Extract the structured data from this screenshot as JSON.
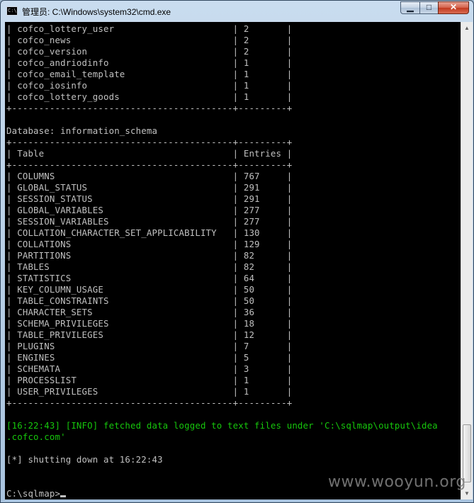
{
  "window": {
    "title": "管理员: C:\\Windows\\system32\\cmd.exe",
    "icon_text": "C:\\",
    "controls": {
      "minimize": "▁",
      "maximize": "□",
      "close": "✕"
    }
  },
  "scrollbar": {
    "up_arrow": "▲",
    "down_arrow": "▼"
  },
  "console": {
    "lines": [
      "| cofco_lottery_user                      | 2       |",
      "| cofco_news                              | 2       |",
      "| cofco_version                           | 2       |",
      "| cofco_andriodinfo                       | 1       |",
      "| cofco_email_template                    | 1       |",
      "| cofco_iosinfo                           | 1       |",
      "| cofco_lottery_goods                     | 1       |",
      "+-----------------------------------------+---------+",
      "",
      "Database: information_schema",
      "+-----------------------------------------+---------+",
      "| Table                                   | Entries |",
      "+-----------------------------------------+---------+",
      "| COLUMNS                                 | 767     |",
      "| GLOBAL_STATUS                           | 291     |",
      "| SESSION_STATUS                          | 291     |",
      "| GLOBAL_VARIABLES                        | 277     |",
      "| SESSION_VARIABLES                       | 277     |",
      "| COLLATION_CHARACTER_SET_APPLICABILITY   | 130     |",
      "| COLLATIONS                              | 129     |",
      "| PARTITIONS                              | 82      |",
      "| TABLES                                  | 82      |",
      "| STATISTICS                              | 64      |",
      "| KEY_COLUMN_USAGE                        | 50      |",
      "| TABLE_CONSTRAINTS                       | 50      |",
      "| CHARACTER_SETS                          | 36      |",
      "| SCHEMA_PRIVILEGES                       | 18      |",
      "| TABLE_PRIVILEGES                        | 12      |",
      "| PLUGINS                                 | 7       |",
      "| ENGINES                                 | 5       |",
      "| SCHEMATA                                | 3       |",
      "| PROCESSLIST                             | 1       |",
      "| USER_PRIVILEGES                         | 1       |",
      "+-----------------------------------------+---------+",
      "",
      "[16:22:43] [INFO] fetched data logged to text files under 'C:\\sqlmap\\output\\idea",
      ".cofco.com'",
      "",
      "[*] shutting down at 16:22:43",
      "",
      "",
      "C:\\sqlmap>"
    ],
    "info_line_indices": [
      35,
      36
    ],
    "prompt": "C:\\sqlmap>"
  },
  "watermark": "www.wooyun.org",
  "colors": {
    "console_bg": "#000000",
    "console_text": "#c0c0c0",
    "info_text": "#16c60c",
    "titlebar": "#b9d1ea"
  }
}
